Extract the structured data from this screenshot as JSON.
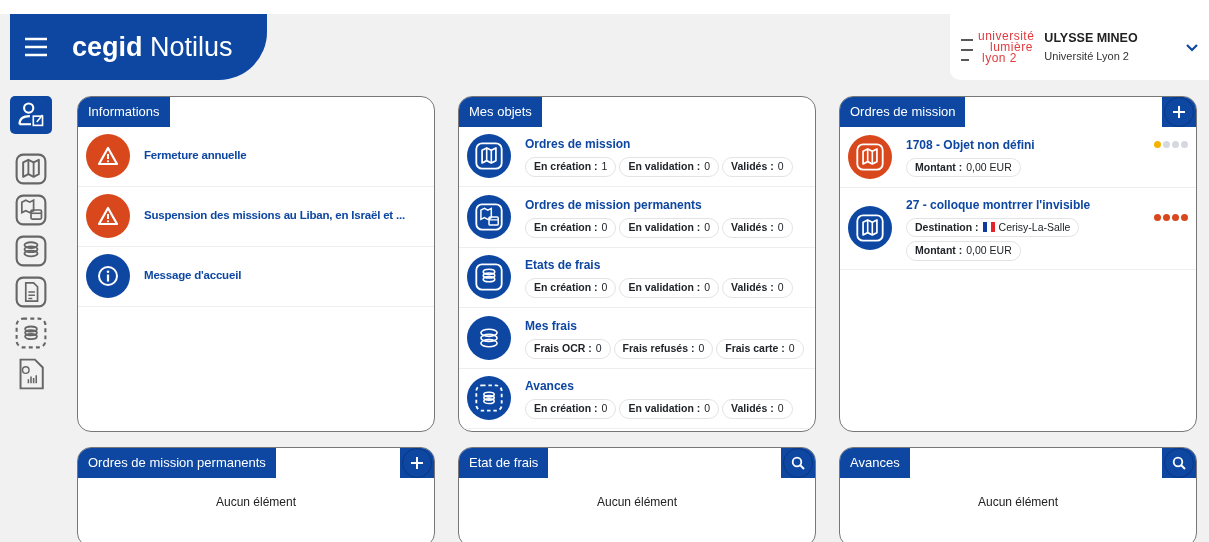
{
  "header": {
    "logo_bold": "cegid",
    "logo_rest": "Notilus"
  },
  "user": {
    "university_lines": [
      "université",
      "lumière",
      "lyon 2"
    ],
    "name": "ULYSSE MINEO",
    "organisation": "Université Lyon 2"
  },
  "rail": [
    {
      "kind": "profile",
      "selected": true
    },
    {
      "kind": "map",
      "selected": false
    },
    {
      "kind": "map-calendar",
      "selected": false
    },
    {
      "kind": "coins-box",
      "selected": false
    },
    {
      "kind": "document",
      "selected": false
    },
    {
      "kind": "dashed-coins",
      "selected": false
    },
    {
      "kind": "report",
      "selected": false
    }
  ],
  "informations": {
    "title": "Informations",
    "items": [
      {
        "kind": "warning",
        "text": "Fermeture annuelle"
      },
      {
        "kind": "warning",
        "text": "Suspension des missions au Liban, en Israël et ..."
      },
      {
        "kind": "info",
        "text": "Message d'accueil"
      }
    ]
  },
  "mes_objets": {
    "title": "Mes objets",
    "items": [
      {
        "kind": "map",
        "title": "Ordres de mission",
        "chips": [
          {
            "label": "En création :",
            "value": "1"
          },
          {
            "label": "En validation :",
            "value": "0"
          },
          {
            "label": "Validés :",
            "value": "0"
          }
        ]
      },
      {
        "kind": "map-calendar",
        "title": "Ordres de mission permanents",
        "chips": [
          {
            "label": "En création :",
            "value": "0"
          },
          {
            "label": "En validation :",
            "value": "0"
          },
          {
            "label": "Validés :",
            "value": "0"
          }
        ]
      },
      {
        "kind": "coins-box",
        "title": "Etats de frais",
        "chips": [
          {
            "label": "En création :",
            "value": "0"
          },
          {
            "label": "En validation :",
            "value": "0"
          },
          {
            "label": "Validés :",
            "value": "0"
          }
        ]
      },
      {
        "kind": "coins",
        "title": "Mes frais",
        "chips": [
          {
            "label": "Frais OCR :",
            "value": "0"
          },
          {
            "label": "Frais refusés :",
            "value": "0"
          },
          {
            "label": "Frais carte :",
            "value": "0"
          }
        ]
      },
      {
        "kind": "dashed-coins",
        "title": "Avances",
        "chips": [
          {
            "label": "En création :",
            "value": "0"
          },
          {
            "label": "En validation :",
            "value": "0"
          },
          {
            "label": "Validés :",
            "value": "0"
          }
        ]
      }
    ]
  },
  "ordres_de_mission": {
    "title": "Ordres de mission",
    "kind": "add",
    "items": [
      {
        "color": "#d9481c",
        "title": "1708 - Objet non défini",
        "chips": [
          {
            "label": "Montant :",
            "value": "0,00 EUR"
          }
        ],
        "steps": [
          {
            "color": "#f5b301"
          },
          {
            "color": "#d5d8de"
          },
          {
            "color": "#d5d8de"
          },
          {
            "color": "#d5d8de"
          }
        ]
      },
      {
        "color": "#0d47a1",
        "title": "27 - colloque montrrer l'invisible",
        "chips": [
          {
            "label": "Destination :",
            "value": "Cerisy-La-Salle",
            "kind": "flag"
          },
          {
            "label": "Montant :",
            "value": "0,00 EUR"
          }
        ],
        "steps": [
          {
            "color": "#d9481c"
          },
          {
            "color": "#d9481c"
          },
          {
            "color": "#d9481c"
          },
          {
            "color": "#d9481c"
          }
        ]
      }
    ]
  },
  "bottom_cards": [
    {
      "title": "Ordres de mission permanents",
      "kind": "add",
      "empty_text": "Aucun élément"
    },
    {
      "title": "Etat de frais",
      "kind": "search",
      "empty_text": "Aucun élément"
    },
    {
      "title": "Avances",
      "kind": "search",
      "empty_text": "Aucun élément"
    }
  ]
}
